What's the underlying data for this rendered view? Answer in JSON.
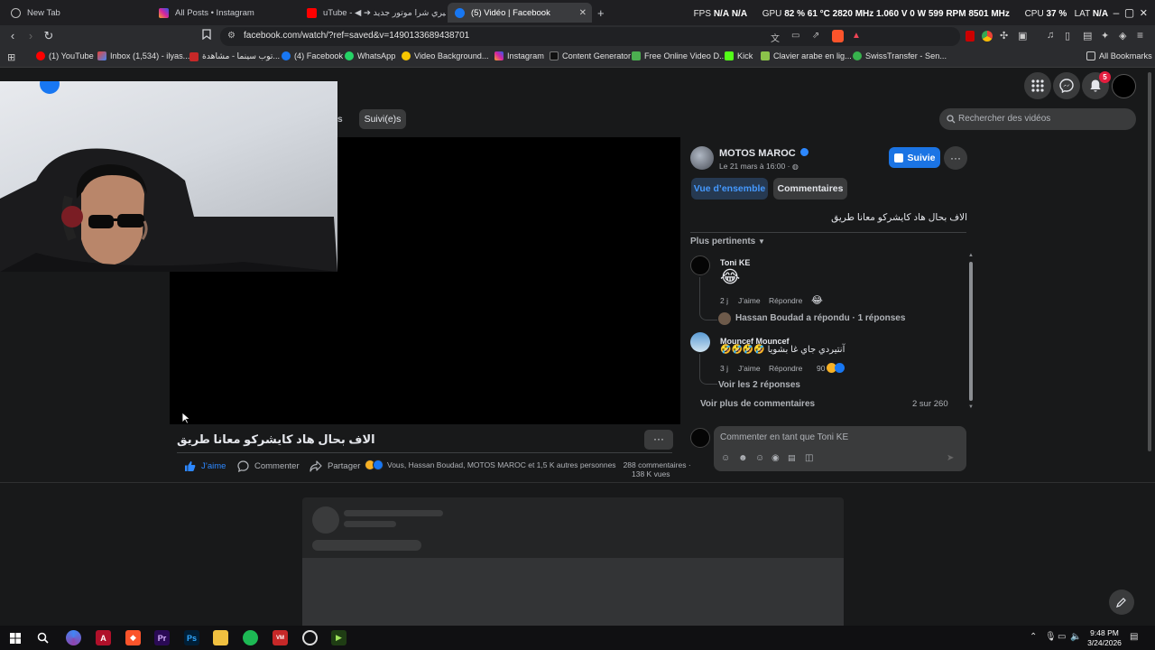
{
  "browser": {
    "tabs": [
      {
        "label": "New Tab"
      },
      {
        "label": "All Posts • Instagram"
      },
      {
        "label": "uTube - ◀ ➔ عشيري شرا موتور جديد"
      },
      {
        "label": "(5) Vidéo | Facebook"
      }
    ],
    "new_tab_glyph": "+",
    "url": "facebook.com/watch/?ref=saved&v=1490133689438701",
    "bookmarks": [
      "(1) YouTube",
      "Inbox (1,534) - ilyas...",
      "توب سينما - مشاهدة...",
      "(4) Facebook",
      "WhatsApp",
      "Video Background...",
      "Instagram",
      "Content Generator",
      "Free Online Video D...",
      "Kick",
      "Clavier arabe en lig...",
      "SwissTransfer - Sen...",
      "All Bookmarks"
    ],
    "hw_stats": {
      "fps_label": "FPS",
      "fps1": "N/A",
      "fps2": "N/A",
      "gpu_label": "GPU",
      "gpu_load": "82 %",
      "gpu_temp": "61 °C",
      "gpu_clock": "2820 MHz",
      "gpu_volt": "1.060 V",
      "gpu_power": "0 W",
      "gpu_fan": "599 RPM",
      "gpu_mem": "8501 MHz",
      "cpu_label": "CPU",
      "cpu_load": "37 %",
      "lat_label": "LAT",
      "lat_value": "N/A"
    }
  },
  "fb": {
    "nav_tab_partial": "es",
    "nav_tab_following": "Suivi(e)s",
    "search_placeholder": "Rechercher des vidéos",
    "notif_count": "5",
    "video_title": "الاف بحال هاد كايشركو معانا طريق",
    "more_glyph": "···",
    "actions": {
      "like": "J’aime",
      "comment": "Commenter",
      "share": "Partager"
    },
    "reactions_text": "Vous, Hassan Boudad, MOTOS MAROC et 1,5 K autres personnes",
    "comments_count": "288 commentaires ·",
    "views": "138 K vues",
    "page": {
      "name": "MOTOS MAROC",
      "date": "Le 21 mars à 16:00 ·",
      "follow_label": "Suivie",
      "tab_overview": "Vue d’ensemble",
      "tab_comments": "Commentaires",
      "caption": "الاف بحال هاد كايشركو معانا طريق",
      "sort_label": "Plus pertinents"
    },
    "comments": [
      {
        "author": "Toni KE",
        "text": "😂",
        "age": "2 j",
        "like": "J’aime",
        "reply": "Répondre",
        "reaction": "😂",
        "replies_text": "Hassan Boudad a répondu · 1 réponses"
      },
      {
        "author": "Mouncef Mouncef",
        "emojis": "🤣🤣🤣🤣",
        "text": "آنتيردي جاي غا بشويا",
        "age": "3 j",
        "like": "J’aime",
        "reply": "Répondre",
        "reaction_count": "90",
        "replies_text": "Voir les 2 réponses"
      }
    ],
    "more_comments": "Voir plus de commentaires",
    "comments_progress": "2 sur 260",
    "comment_placeholder": "Commenter en tant que Toni KE"
  },
  "taskbar": {
    "time": "9:48 PM",
    "date": "3/24/2026"
  },
  "colors": {
    "accent": "#2d88ff",
    "follow_bg": "#1b74e4",
    "overview_bg": "#263951"
  }
}
